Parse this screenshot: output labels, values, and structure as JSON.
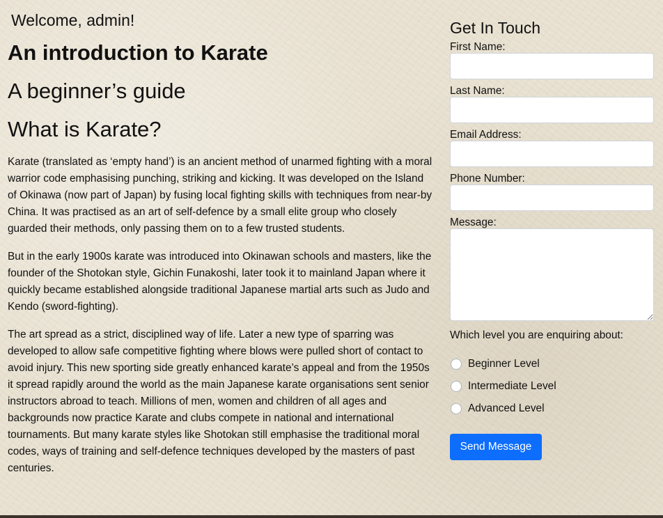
{
  "header": {
    "welcome": "Welcome, admin!"
  },
  "main": {
    "title": "An introduction to Karate",
    "subtitle": "A beginner’s guide",
    "section_heading": "What is Karate?",
    "paragraphs": [
      "Karate (translated as ‘empty hand’) is an ancient method of unarmed fighting with a moral warrior code emphasising punching, striking and kicking. It was developed on the Island of Okinawa (now part of Japan) by fusing local fighting skills with techniques from near-by China. It was practised as an art of self-defence by a small elite group who closely guarded their methods, only passing them on to a few trusted students.",
      "But in the early 1900s karate was introduced into Okinawan schools and masters, like the founder of the Shotokan style, Gichin Funakoshi, later took it to mainland Japan where it quickly became established alongside traditional Japanese martial arts such as Judo and Kendo (sword-fighting).",
      "The art spread as a strict, disciplined way of life. Later a new type of sparring was developed to allow safe competitive fighting where blows were pulled short of contact to avoid injury. This new sporting side greatly enhanced karate’s appeal and from the 1950s it spread rapidly around the world as the main Japanese karate organisations sent senior instructors abroad to teach. Millions of men, women and children of all ages and backgrounds now practice Karate and clubs compete in national and international tournaments. But many karate styles like Shotokan still emphasise the traditional moral codes, ways of training and self-defence techniques developed by the masters of past centuries."
    ]
  },
  "contact": {
    "heading": "Get In Touch",
    "first_name_label": "First Name:",
    "first_name_value": "",
    "last_name_label": "Last Name:",
    "last_name_value": "",
    "email_label": "Email Address:",
    "email_value": "",
    "phone_label": "Phone Number:",
    "phone_value": "",
    "message_label": "Message:",
    "message_value": "",
    "level_question": "Which level you are enquiring about:",
    "levels": [
      {
        "label": "Beginner Level",
        "selected": false
      },
      {
        "label": "Intermediate Level",
        "selected": false
      },
      {
        "label": "Advanced Level",
        "selected": false
      }
    ],
    "submit_label": "Send Message",
    "submit_color": "#0d6efd"
  }
}
